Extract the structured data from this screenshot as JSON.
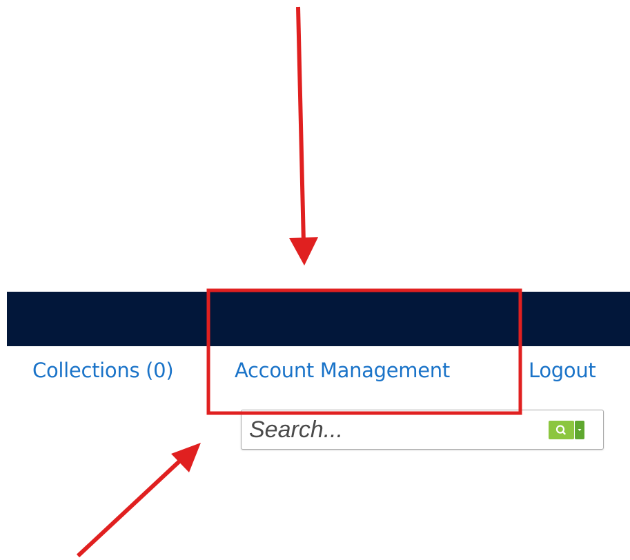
{
  "nav": {
    "collections_label": "Collections (0)",
    "account_label": "Account Management",
    "logout_label": "Logout"
  },
  "search": {
    "placeholder": "Search...",
    "value": ""
  },
  "icons": {
    "search_button": "magnifier-icon",
    "search_options": "caret-down-icon"
  },
  "colors": {
    "header_bar": "#02173a",
    "link": "#1a73c8",
    "search_button": "#8cc63f",
    "search_dropdown": "#5fa82f",
    "annotation": "#e02020"
  }
}
